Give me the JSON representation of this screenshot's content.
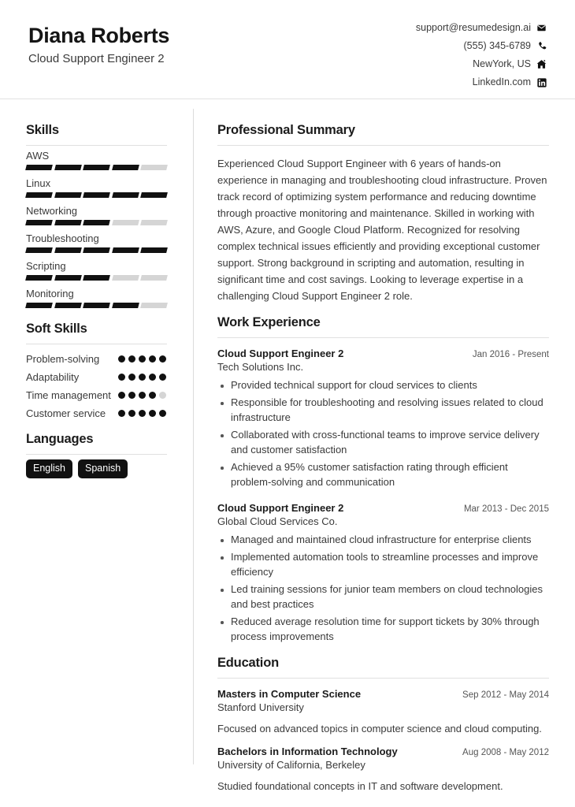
{
  "header": {
    "name": "Diana Roberts",
    "job_title": "Cloud Support Engineer 2",
    "contacts": [
      {
        "text": "support@resumedesign.ai",
        "icon": "email-icon"
      },
      {
        "text": "(555) 345-6789",
        "icon": "phone-icon"
      },
      {
        "text": "NewYork, US",
        "icon": "home-icon"
      },
      {
        "text": "LinkedIn.com",
        "icon": "linkedin-icon"
      }
    ]
  },
  "sidebar": {
    "skills": {
      "title": "Skills",
      "max": 5,
      "items": [
        {
          "name": "AWS",
          "level": 4
        },
        {
          "name": "Linux",
          "level": 5
        },
        {
          "name": "Networking",
          "level": 3
        },
        {
          "name": "Troubleshooting",
          "level": 5
        },
        {
          "name": "Scripting",
          "level": 3
        },
        {
          "name": "Monitoring",
          "level": 4
        }
      ]
    },
    "soft_skills": {
      "title": "Soft Skills",
      "max": 5,
      "items": [
        {
          "name": "Problem-solving",
          "level": 5
        },
        {
          "name": "Adaptability",
          "level": 5
        },
        {
          "name": "Time management",
          "level": 4
        },
        {
          "name": "Customer service",
          "level": 5
        }
      ]
    },
    "languages": {
      "title": "Languages",
      "items": [
        "English",
        "Spanish"
      ]
    }
  },
  "main": {
    "summary": {
      "title": "Professional Summary",
      "text": "Experienced Cloud Support Engineer with 6 years of hands-on experience in managing and troubleshooting cloud infrastructure. Proven track record of optimizing system performance and reducing downtime through proactive monitoring and maintenance. Skilled in working with AWS, Azure, and Google Cloud Platform. Recognized for resolving complex technical issues efficiently and providing exceptional customer support. Strong background in scripting and automation, resulting in significant time and cost savings. Looking to leverage expertise in a challenging Cloud Support Engineer 2 role."
    },
    "experience": {
      "title": "Work Experience",
      "entries": [
        {
          "title": "Cloud Support Engineer 2",
          "date": "Jan 2016 - Present",
          "org": "Tech Solutions Inc.",
          "bullets": [
            "Provided technical support for cloud services to clients",
            "Responsible for troubleshooting and resolving issues related to cloud infrastructure",
            "Collaborated with cross-functional teams to improve service delivery and customer satisfaction",
            "Achieved a 95% customer satisfaction rating through efficient problem-solving and communication"
          ]
        },
        {
          "title": "Cloud Support Engineer 2",
          "date": "Mar 2013 - Dec 2015",
          "org": "Global Cloud Services Co.",
          "bullets": [
            "Managed and maintained cloud infrastructure for enterprise clients",
            "Implemented automation tools to streamline processes and improve efficiency",
            "Led training sessions for junior team members on cloud technologies and best practices",
            "Reduced average resolution time for support tickets by 30% through process improvements"
          ]
        }
      ]
    },
    "education": {
      "title": "Education",
      "entries": [
        {
          "title": "Masters in Computer Science",
          "date": "Sep 2012 - May 2014",
          "org": "Stanford University",
          "description": "Focused on advanced topics in computer science and cloud computing."
        },
        {
          "title": "Bachelors in Information Technology",
          "date": "Aug 2008 - May 2012",
          "org": "University of California, Berkeley",
          "description": "Studied foundational concepts in IT and software development."
        }
      ]
    }
  }
}
